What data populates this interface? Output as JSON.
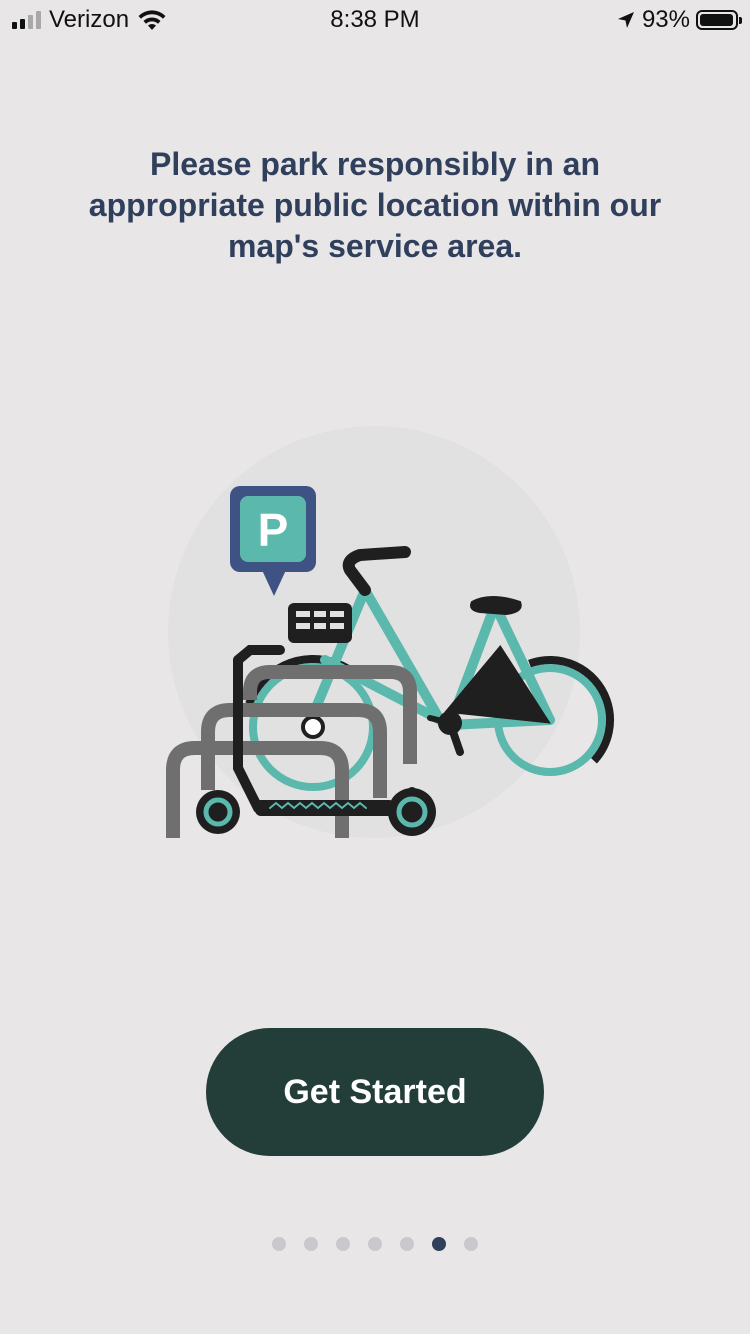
{
  "status_bar": {
    "carrier": "Verizon",
    "time": "8:38 PM",
    "battery_percent": "93%",
    "battery_level": 0.93,
    "signal_bars_on": 2,
    "signal_bars_total": 4
  },
  "onboarding": {
    "message": "Please park responsibly in an appropriate public location within our map's service area.",
    "parking_badge_letter": "P",
    "cta_label": "Get Started",
    "page_indicator": {
      "total": 7,
      "active_index": 5
    }
  },
  "colors": {
    "background": "#e8e6e7",
    "title": "#2f3f5c",
    "button": "#233d38",
    "teal": "#5bb8ac",
    "rack_gray": "#6f6f6f",
    "dot_active": "#2f3f5c",
    "dot_inactive": "#c9c8cd"
  }
}
